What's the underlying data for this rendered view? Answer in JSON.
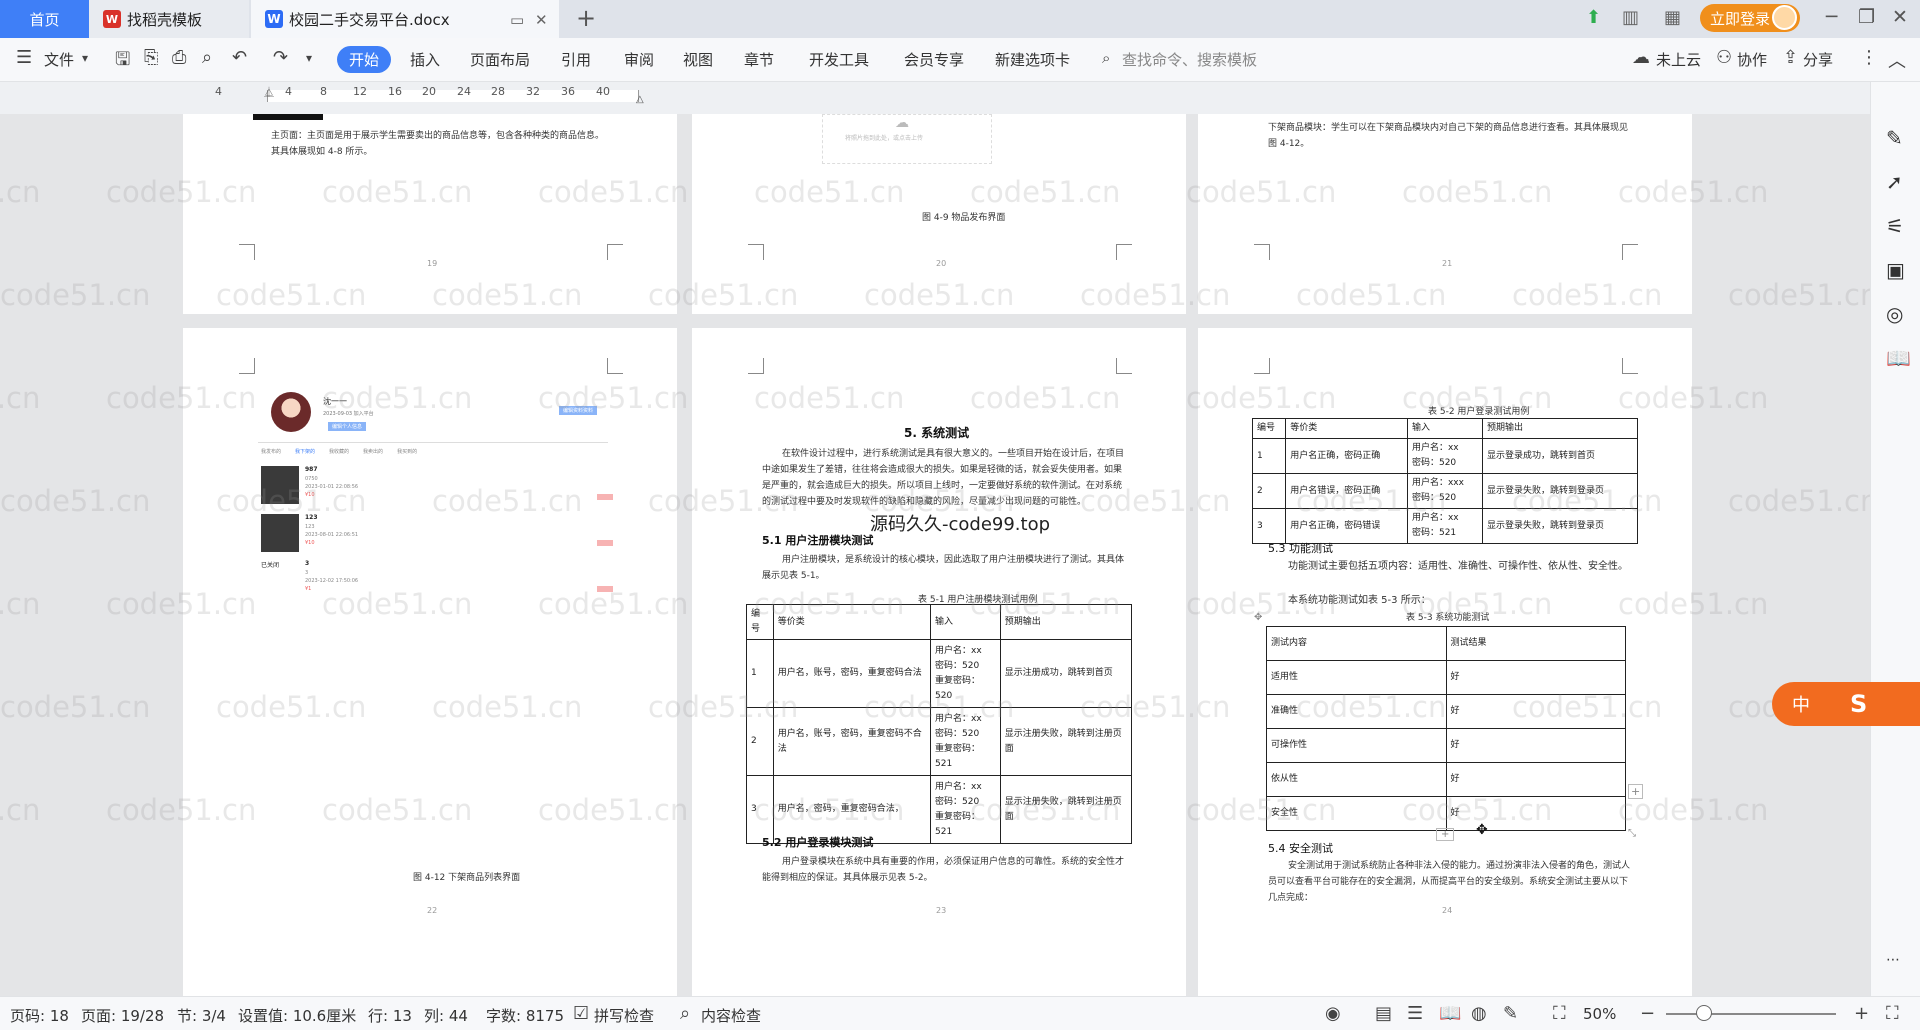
{
  "tabs": {
    "home": "首页",
    "t2": "找稻壳模板",
    "t3": "校园二手交易平台.docx"
  },
  "titlebar": {
    "login": "立即登录"
  },
  "ribbon": {
    "file": "文件",
    "items": [
      "开始",
      "插入",
      "页面布局",
      "引用",
      "审阅",
      "视图",
      "章节",
      "开发工具",
      "会员专享",
      "新建选项卡"
    ],
    "search": "查找命令、搜索模板",
    "cloud": "未上云",
    "collab": "协作",
    "share": "分享"
  },
  "ruler": {
    "ticks": [
      "4",
      "4",
      "8",
      "12",
      "16",
      "20",
      "24",
      "28",
      "32",
      "36",
      "40"
    ]
  },
  "watermark": "code51.cn",
  "center_watermark": "源码久久-code99.top",
  "pages": {
    "p19": {
      "text": "主页面：主页面是用于展示学生需要卖出的商品信息等，包含各种种类的商品信息。其具体展现如 4-8 所示。",
      "num": "19"
    },
    "p20": {
      "caption": "图 4-9 物品发布界面",
      "upload": "将照片拖到此处，或点击上传",
      "num": "20"
    },
    "p21": {
      "text": "下架商品模块：学生可以在下架商品模块内对自己下架的商品信息进行查看。其具体展现见图 4-12。",
      "num": "21"
    },
    "p22": {
      "profile_name": "沈一一",
      "profile_date": "2023-09-03 加入平台",
      "profile_btn": "编辑个人信息",
      "profile_tag": "编辑资料资料",
      "subtabs": [
        "我发布的",
        "我下架的",
        "我收藏的",
        "我卖出的",
        "我买到的"
      ],
      "items": [
        {
          "title": "987",
          "sub": "0750",
          "date": "2023-01-01 22:08:56",
          "price": "¥10"
        },
        {
          "title": "123",
          "sub": "123",
          "date": "2023-08-01 22:06:51",
          "price": "¥10"
        },
        {
          "title": "3",
          "sub": "3",
          "date": "2023-12-02 17:50:06",
          "price": "¥1"
        }
      ],
      "side": "已关闭",
      "caption": "图 4-12 下架商品列表界面",
      "num": "22"
    },
    "p23": {
      "heading": "5. 系统测试",
      "para1": "在软件设计过程中，进行系统测试是具有很大意义的。一些项目开始在设计后，在项目中途如果发生了差错，往往将会造成很大的损失。如果是轻微的话，就会妥失使用者。如果是严重的，就会造成巨大的损失。所以项目上线时，一定要做好系统的软件测试。在对系统的测试过程中要及时发现软件的缺陷和隐藏的风险，尽量减少出现问题的可能性。",
      "h51": "5.1 用户注册模块测试",
      "para2": "用户注册模块，是系统设计的核心模块，因此选取了用户注册模块进行了测试。其具体展示见表 5-1。",
      "cap1": "表 5-1 用户注册模块测试用例",
      "t1_head": [
        "编号",
        "等价类",
        "输入",
        "预期输出"
      ],
      "t1_rows": [
        [
          "1",
          "用户名，账号，密码，重复密码合法",
          "用户名：xx\n密码：520\n重复密码：520",
          "显示注册成功，跳转到首页"
        ],
        [
          "2",
          "用户名，账号，密码，重复密码不合法",
          "用户名：xx\n密码：520\n重复密码：521",
          "显示注册失败，跳转到注册页面"
        ],
        [
          "3",
          "用户名，密码，重复密码合法，",
          "用户名：xx\n密码：520\n重复密码：521",
          "显示注册失败，跳转到注册页面"
        ]
      ],
      "h52": "5.2 用户登录模块测试",
      "para3": "用户登录模块在系统中具有重要的作用，必须保证用户信息的可靠性。系统的安全性才能得到相应的保证。其具体展示见表 5-2。",
      "num": "23"
    },
    "p24": {
      "cap2": "表 5-2 用户登录测试用例",
      "t2_head": [
        "编号",
        "等价类",
        "输入",
        "预期输出"
      ],
      "t2_rows": [
        [
          "1",
          "用户名正确，密码正确",
          "用户名：xx\n密码：520",
          "显示登录成功，跳转到首页"
        ],
        [
          "2",
          "用户名错误，密码正确",
          "用户名：xxx\n密码：520",
          "显示登录失败，跳转到登录页"
        ],
        [
          "3",
          "用户名正确，密码错误",
          "用户名：xx\n密码：521",
          "显示登录失败，跳转到登录页"
        ]
      ],
      "h53": "5.3 功能测试",
      "para1": "功能测试主要包括五项内容：适用性、准确性、可操作性、依从性、安全性。",
      "para2": "本系统功能测试如表 5-3 所示：",
      "cap3": "表 5-3 系统功能测试",
      "t3_head": [
        "测试内容",
        "测试结果"
      ],
      "t3_rows": [
        [
          "适用性",
          "好"
        ],
        [
          "准确性",
          "好"
        ],
        [
          "可操作性",
          "好"
        ],
        [
          "依从性",
          "好"
        ],
        [
          "安全性",
          "好"
        ]
      ],
      "h54": "5.4 安全测试",
      "para3": "安全测试用于测试系统防止各种非法入侵的能力。通过扮演非法入侵者的角色，测试人员可以查看平台可能存在的安全漏洞，从而提高平台的安全级别。系统安全测试主要从以下几点完成：",
      "num": "24"
    }
  },
  "float_btn": "中",
  "status": {
    "page_code": "页码: 18",
    "page": "页面: 19/28",
    "section": "节: 3/4",
    "setting": "设置值: 10.6厘米",
    "row": "行: 13",
    "col": "列: 44",
    "words": "字数: 8175",
    "spell": "拼写检查",
    "content": "内容检查",
    "zoom": "50%"
  }
}
